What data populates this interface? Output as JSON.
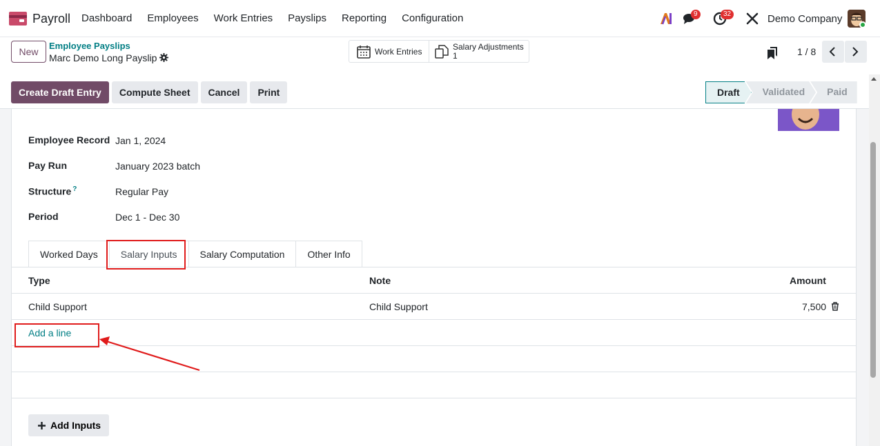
{
  "navbar": {
    "app_name": "Payroll",
    "menu": [
      "Dashboard",
      "Employees",
      "Work Entries",
      "Payslips",
      "Reporting",
      "Configuration"
    ],
    "messages_count": "9",
    "activities_count": "32",
    "company": "Demo Company"
  },
  "control": {
    "new_label": "New",
    "breadcrumb_parent": "Employee Payslips",
    "breadcrumb_current": "Marc Demo Long Payslip",
    "smart_buttons": {
      "work_entries": "Work Entries",
      "salary_adjustments": "Salary Adjustments",
      "salary_adjustments_count": "1"
    },
    "pager": "1 / 8"
  },
  "actions": {
    "create_draft_entry": "Create Draft Entry",
    "compute_sheet": "Compute Sheet",
    "cancel": "Cancel",
    "print": "Print"
  },
  "statusbar": [
    "Draft",
    "Validated",
    "Paid"
  ],
  "form": {
    "fields": [
      {
        "label": "Employee Record",
        "value": "Jan 1, 2024"
      },
      {
        "label": "Pay Run",
        "value": "January 2023 batch"
      },
      {
        "label": "Structure",
        "value": "Regular Pay",
        "help": "?"
      },
      {
        "label": "Period",
        "value": "Dec 1 - Dec 30"
      }
    ],
    "tabs": [
      "Worked Days",
      "Salary Inputs",
      "Salary Computation",
      "Other Info"
    ],
    "active_tab": "Salary Inputs",
    "table": {
      "headers": {
        "type": "Type",
        "note": "Note",
        "amount": "Amount"
      },
      "rows": [
        {
          "type": "Child Support",
          "note": "Child Support",
          "amount": "7,500"
        }
      ],
      "add_line": "Add a line"
    },
    "add_inputs": "Add Inputs"
  },
  "colors": {
    "brand": "#714b67",
    "link": "#017e84",
    "annotation": "#e01b1b"
  }
}
